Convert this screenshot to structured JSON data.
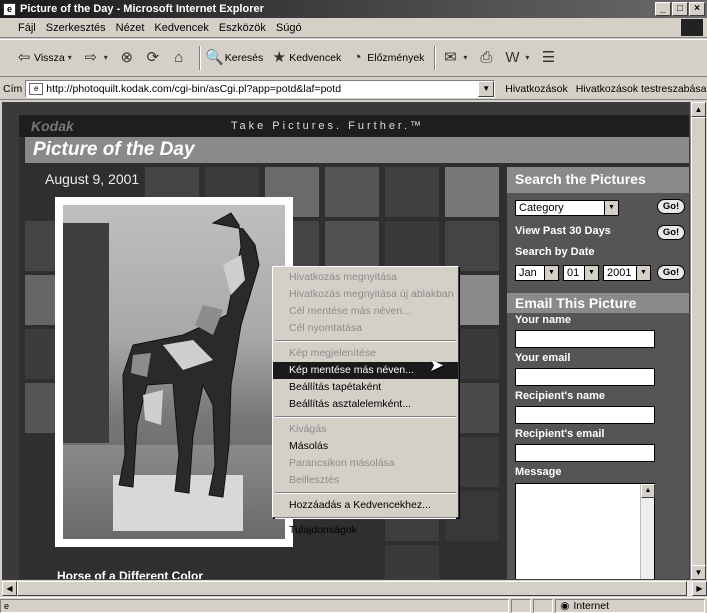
{
  "window": {
    "title": "Picture of the Day - Microsoft Internet Explorer"
  },
  "menu": [
    "Fájl",
    "Szerkesztés",
    "Nézet",
    "Kedvencek",
    "Eszközök",
    "Súgó"
  ],
  "toolbar": {
    "back": "Vissza",
    "search": "Keresés",
    "favorites": "Kedvencek",
    "history": "Előzmények"
  },
  "address": {
    "label": "Cím",
    "url": "http://photoquilt.kodak.com/cgi-bin/asCgi.pl?app=potd&laf=potd",
    "links": "Hivatkozások",
    "link1": "Hivatkozások testreszabása"
  },
  "page": {
    "logo": "Kodak",
    "tagline": "Take Pictures. Further.™",
    "section_title": "Picture of the Day",
    "date": "August 9, 2001",
    "caption": "Horse of a Different Color"
  },
  "sidebar": {
    "search_head": "Search the Pictures",
    "category": "Category",
    "go": "Go!",
    "past30": "View Past 30 Days",
    "bydate": "Search by Date",
    "month": "Jan",
    "day": "01",
    "year": "2001",
    "email_head": "Email This Picture",
    "your_name": "Your name",
    "your_email": "Your email",
    "recip_name": "Recipient's name",
    "recip_email": "Recipient's email",
    "message": "Message"
  },
  "context_menu": {
    "open_link": "Hivatkozás megnyitása",
    "open_link_new": "Hivatkozás megnyitása új ablakban",
    "save_target": "Cél mentése más néven...",
    "print_target": "Cél nyomtatása",
    "show_picture": "Kép megjelenítése",
    "save_picture": "Kép mentése más néven...",
    "set_wallpaper": "Beállítás tapétaként",
    "set_desktop": "Beállítás asztalelemként...",
    "cut": "Kivágás",
    "copy": "Másolás",
    "copy_shortcut": "Parancsikon másolása",
    "paste": "Beillesztés",
    "add_favorites": "Hozzáadás a Kedvencekhez...",
    "properties": "Tulajdonságok"
  },
  "status": {
    "zone": "Internet"
  }
}
